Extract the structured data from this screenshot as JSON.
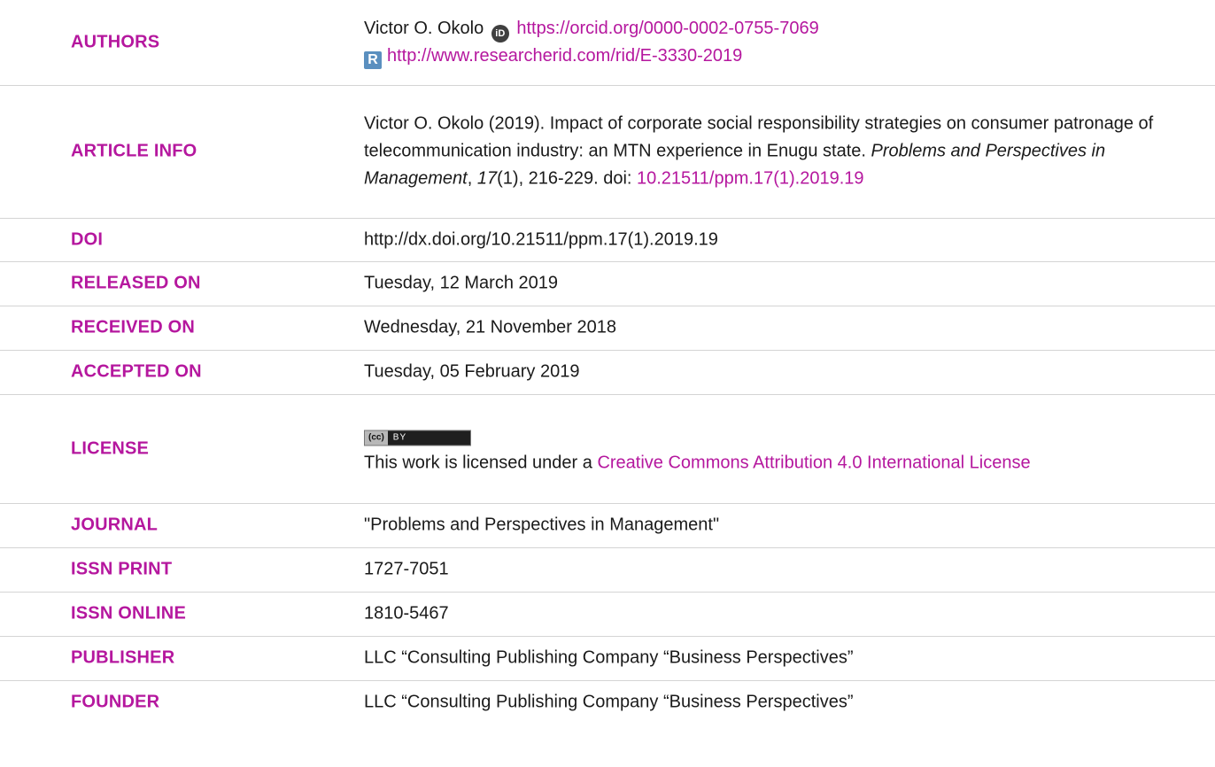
{
  "colors": {
    "accent": "#b5179e",
    "orcid": "#3f3f3f",
    "researcherid": "#5a8fbf"
  },
  "authors": {
    "label": "AUTHORS",
    "name": "Victor O. Okolo",
    "orcid_url": "https://orcid.org/0000-0002-0755-7069",
    "researcherid_url": "http://www.researcherid.com/rid/E-3330-2019"
  },
  "article_info": {
    "label": "ARTICLE INFO",
    "citation_lead": "Victor O. Okolo (2019). Impact of corporate social responsibility strategies on consumer patronage of telecommunication industry: an MTN experience in Enugu state. ",
    "journal_italic": "Problems and Perspectives in Management",
    "comma": ", ",
    "volume_italic": "17",
    "issue_pages": "(1), 216-229. doi: ",
    "doi_link": "10.21511/ppm.17(1).2019.19"
  },
  "doi": {
    "label": "DOI",
    "value": "http://dx.doi.org/10.21511/ppm.17(1).2019.19"
  },
  "released_on": {
    "label": "RELEASED ON",
    "value": "Tuesday, 12 March 2019"
  },
  "received_on": {
    "label": "RECEIVED ON",
    "value": "Wednesday, 21 November 2018"
  },
  "accepted_on": {
    "label": "ACCEPTED ON",
    "value": "Tuesday, 05 February 2019"
  },
  "license": {
    "label": "LICENSE",
    "text_lead": "This work is licensed under a ",
    "link_text": "Creative Commons Attribution 4.0 International License"
  },
  "journal": {
    "label": "JOURNAL",
    "value": "\"Problems and Perspectives in Management\""
  },
  "issn_print": {
    "label": "ISSN PRINT",
    "value": "1727-7051"
  },
  "issn_online": {
    "label": "ISSN ONLINE",
    "value": "1810-5467"
  },
  "publisher": {
    "label": "PUBLISHER",
    "value": "LLC “Consulting Publishing Company “Business Perspectives”"
  },
  "founder": {
    "label": "FOUNDER",
    "value": "LLC “Consulting Publishing Company “Business Perspectives”"
  }
}
